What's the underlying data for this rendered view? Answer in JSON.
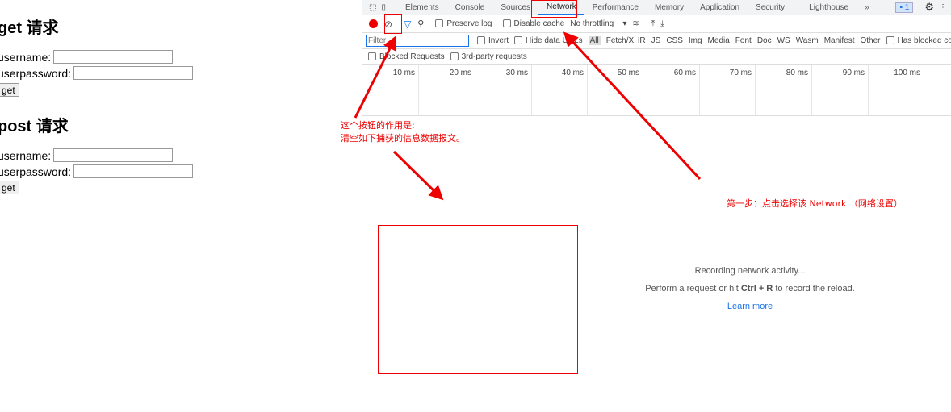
{
  "page": {
    "get_title": "get 请求",
    "post_title": "post 请求",
    "username_label": "username:",
    "password_label": "userpassword:",
    "get_button": "get",
    "post_button": "get"
  },
  "devtools": {
    "tabs": [
      "Elements",
      "Console",
      "Sources",
      "Network",
      "Performance",
      "Memory",
      "Application",
      "Security",
      "Lighthouse"
    ],
    "more_tabs": "»",
    "issues_count": "1",
    "toolbar": {
      "preserve_log": "Preserve log",
      "disable_cache": "Disable cache",
      "throttling": "No throttling"
    },
    "filter": {
      "placeholder": "Filter",
      "invert": "Invert",
      "hide_data_urls": "Hide data URLs",
      "types": [
        "All",
        "Fetch/XHR",
        "JS",
        "CSS",
        "Img",
        "Media",
        "Font",
        "Doc",
        "WS",
        "Wasm",
        "Manifest",
        "Other"
      ],
      "has_blocked_cookies": "Has blocked cookies",
      "blocked_requests": "Blocked Requests",
      "third_party": "3rd-party requests"
    },
    "timeline": [
      "10 ms",
      "20 ms",
      "30 ms",
      "40 ms",
      "50 ms",
      "60 ms",
      "70 ms",
      "80 ms",
      "90 ms",
      "100 ms"
    ],
    "empty": {
      "recording": "Recording network activity...",
      "hint_pre": "Perform a request or hit ",
      "shortcut": "Ctrl + R",
      "hint_post": " to record the reload.",
      "learn_more": "Learn more"
    }
  },
  "annotations": {
    "clear_line1": "这个按钮的作用是:",
    "clear_line2": "清空如下捕获的信息数据报文。",
    "step1": "第一步：点击选择该 Network （网络设置）"
  }
}
